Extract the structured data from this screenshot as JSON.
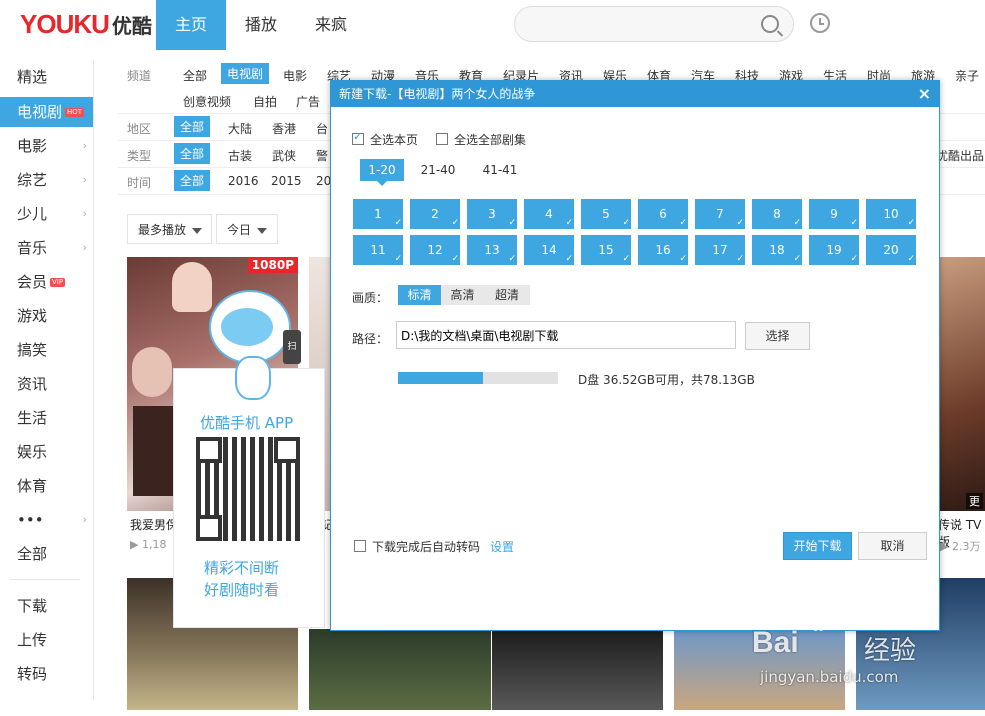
{
  "header": {
    "logo_text": "YOUKU",
    "logo_cn": "优酷",
    "tabs": [
      {
        "label": "主页",
        "active": true
      },
      {
        "label": "播放",
        "active": false
      },
      {
        "label": "来疯",
        "active": false
      }
    ],
    "search": {
      "placeholder": ""
    }
  },
  "sidebar": {
    "items": [
      {
        "label": "精选"
      },
      {
        "label": "电视剧",
        "badge": "HOT",
        "active": true
      },
      {
        "label": "电影"
      },
      {
        "label": "综艺"
      },
      {
        "label": "少儿"
      },
      {
        "label": "音乐"
      },
      {
        "label": "会员",
        "badge": "VIP"
      },
      {
        "label": "游戏"
      },
      {
        "label": "搞笑"
      },
      {
        "label": "资讯"
      },
      {
        "label": "生活"
      },
      {
        "label": "娱乐"
      },
      {
        "label": "体育"
      },
      {
        "label": "•••"
      },
      {
        "label": "全部"
      }
    ],
    "bottom_items": [
      {
        "label": "下载"
      },
      {
        "label": "上传"
      },
      {
        "label": "转码"
      }
    ]
  },
  "filters": {
    "channel_label": "频道",
    "channels": [
      "全部",
      "电视剧",
      "电影",
      "综艺",
      "动漫",
      "音乐",
      "教育",
      "纪录片",
      "资讯",
      "娱乐",
      "体育",
      "汽车",
      "科技",
      "游戏",
      "生活",
      "时尚",
      "旅游",
      "亲子"
    ],
    "channels_row2": [
      "创意视频",
      "自拍",
      "广告"
    ],
    "region_label": "地区",
    "regions": [
      "全部",
      "大陆",
      "香港",
      "台"
    ],
    "type_label": "类型",
    "types": [
      "全部",
      "古装",
      "武侠",
      "警"
    ],
    "type_right": "优酷出品",
    "time_label": "时间",
    "times": [
      "全部",
      "2016",
      "2015",
      "20"
    ],
    "sort": {
      "label": "最多播放"
    },
    "period": {
      "label": "今日"
    }
  },
  "posters": [
    {
      "badge": "1080P",
      "title": "我爱男保",
      "meta": "1,18"
    },
    {
      "title": "记",
      "meta": ""
    },
    {
      "title": "传说 TV版",
      "meta": "2.3万",
      "more": "更"
    }
  ],
  "promo": {
    "title": "优酷手机 APP",
    "scan_label": "扫",
    "line1": "精彩不间断",
    "line2": "好剧随时看"
  },
  "dialog": {
    "title": "新建下载-【电视剧】两个女人的战争",
    "close": "×",
    "select_page": "全选本页",
    "select_all": "全选全部剧集",
    "ranges": [
      "1-20",
      "21-40",
      "41-41"
    ],
    "episodes": [
      "1",
      "2",
      "3",
      "4",
      "5",
      "6",
      "7",
      "8",
      "9",
      "10",
      "11",
      "12",
      "13",
      "14",
      "15",
      "16",
      "17",
      "18",
      "19",
      "20"
    ],
    "quality_label": "画质：",
    "qualities": [
      "标清",
      "高清",
      "超清"
    ],
    "path_label": "路径：",
    "path_value": "D:\\我的文档\\桌面\\电视剧下载",
    "browse": "选择",
    "disk_used_fraction": 0.53,
    "disk_info": "D盘 36.52GB可用，共78.13GB",
    "auto_transcode": "下载完成后自动转码",
    "settings": "设置",
    "start": "开始下载",
    "cancel": "取消"
  },
  "watermark": {
    "brand": "Bai",
    "brand2": "经验",
    "url": "jingyan.baidu.com"
  }
}
